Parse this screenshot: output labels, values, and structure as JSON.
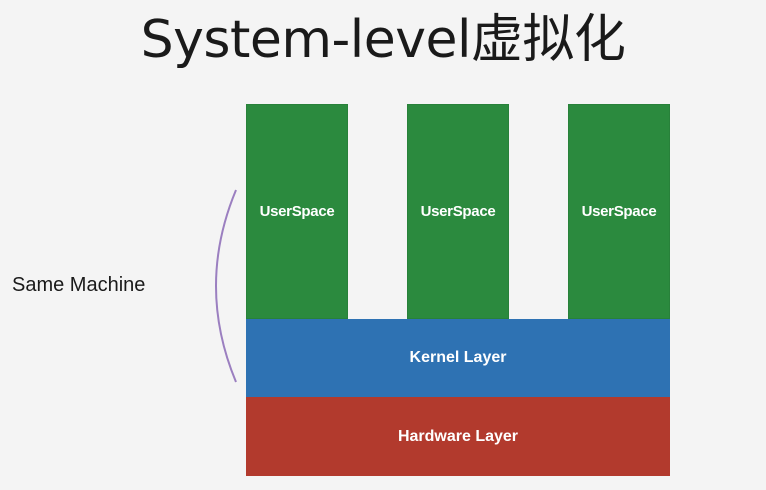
{
  "title": "System-level虚拟化",
  "bracket_label": "Same Machine",
  "user_spaces": [
    {
      "label": "UserSpace"
    },
    {
      "label": "UserSpace"
    },
    {
      "label": "UserSpace"
    }
  ],
  "kernel_layer": {
    "label": "Kernel Layer"
  },
  "hardware_layer": {
    "label": "Hardware Layer"
  },
  "colors": {
    "userspace": "#2b8a3e",
    "kernel": "#2e72b3",
    "hardware": "#b23a2d",
    "bracket": "#9b7fc0",
    "background": "#f4f4f4"
  }
}
